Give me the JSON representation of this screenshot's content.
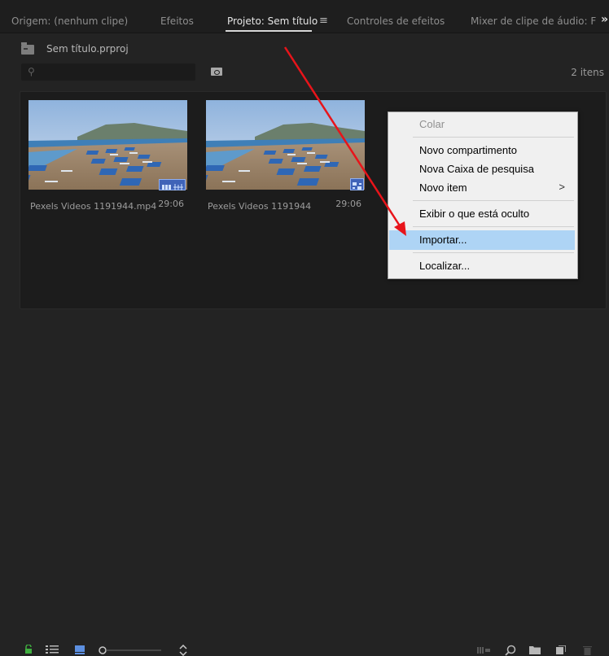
{
  "tabs": [
    {
      "label": "Origem: (nenhum clipe)"
    },
    {
      "label": "Efeitos"
    },
    {
      "label": "Projeto: Sem título",
      "active": true
    },
    {
      "label": "Controles de efeitos"
    },
    {
      "label": "Mixer de clipe de áudio: F"
    }
  ],
  "panel_menu_icon": "hamburger-icon",
  "close_icon": "double-chevron-right-icon",
  "project": {
    "name": "Sem título.prproj"
  },
  "search": {
    "placeholder": "",
    "icon": "search-icon"
  },
  "item_count": "2 itens",
  "clips": [
    {
      "name": "Pexels Videos 1191944.mp4",
      "duration": "29:06",
      "badge": "audio-video-icon"
    },
    {
      "name": "Pexels Videos 1191944",
      "duration": "29:06",
      "badge": "sequence-icon"
    }
  ],
  "context_menu": {
    "items": [
      {
        "label": "Colar",
        "disabled": true
      },
      {
        "label": "Novo compartimento"
      },
      {
        "label": "Nova Caixa de pesquisa"
      },
      {
        "label": "Novo item",
        "submenu": ">"
      },
      {
        "label": "Exibir o que está oculto"
      },
      {
        "label": "Importar..."
      },
      {
        "label": "Localizar..."
      }
    ],
    "highlighted": "Importar..."
  },
  "colors": {
    "annotation_arrow": "#e8141a",
    "highlight": "#aed4f5",
    "lock": "#3fae3f",
    "list_view_icon": "#5c8fe0"
  },
  "bottom_icons": {
    "left": [
      "lock-icon",
      "list-view-icon",
      "icon-view-icon",
      "zoom-slider",
      "sort-icon"
    ],
    "right": [
      "automate-to-sequence-icon",
      "find-icon",
      "new-bin-icon",
      "new-item-icon",
      "trash-icon"
    ]
  }
}
